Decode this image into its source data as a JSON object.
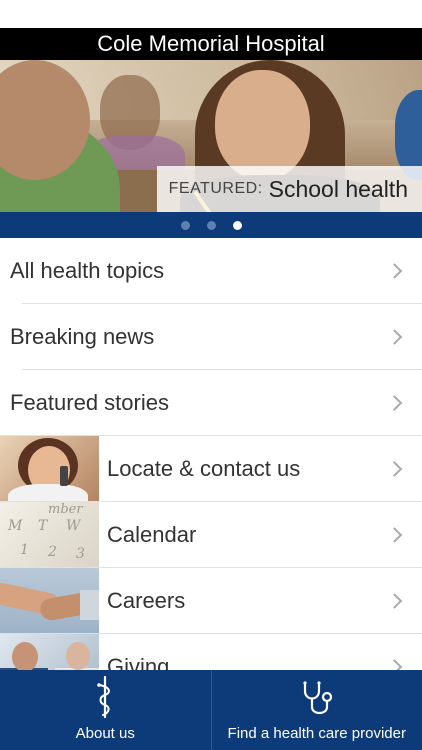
{
  "app": {
    "title": "Cole Memorial Hospital"
  },
  "hero": {
    "featured_prefix": "FEATURED:",
    "featured_topic": "School health",
    "pager": {
      "count": 3,
      "active_index": 2
    }
  },
  "menu": {
    "items": [
      {
        "label": "All health topics",
        "thumbnail": null
      },
      {
        "label": "Breaking news",
        "thumbnail": null
      },
      {
        "label": "Featured stories",
        "thumbnail": null
      },
      {
        "label": "Locate & contact us",
        "thumbnail": "woman-on-phone-photo"
      },
      {
        "label": "Calendar",
        "thumbnail": "calendar-photo",
        "thumbnail_text": [
          "mber",
          "M",
          "T",
          "W",
          "1",
          "2",
          "3"
        ]
      },
      {
        "label": "Careers",
        "thumbnail": "handshake-photo"
      },
      {
        "label": "Giving",
        "thumbnail": "doctors-photo"
      }
    ]
  },
  "tabbar": {
    "tabs": [
      {
        "label": "About us",
        "icon": "caduceus-icon"
      },
      {
        "label": "Find a health care provider",
        "icon": "stethoscope-icon"
      }
    ]
  },
  "colors": {
    "brand_navy": "#0d3a78",
    "title_bar": "#000000",
    "text": "#333333",
    "chevron": "#a9a9a9"
  }
}
